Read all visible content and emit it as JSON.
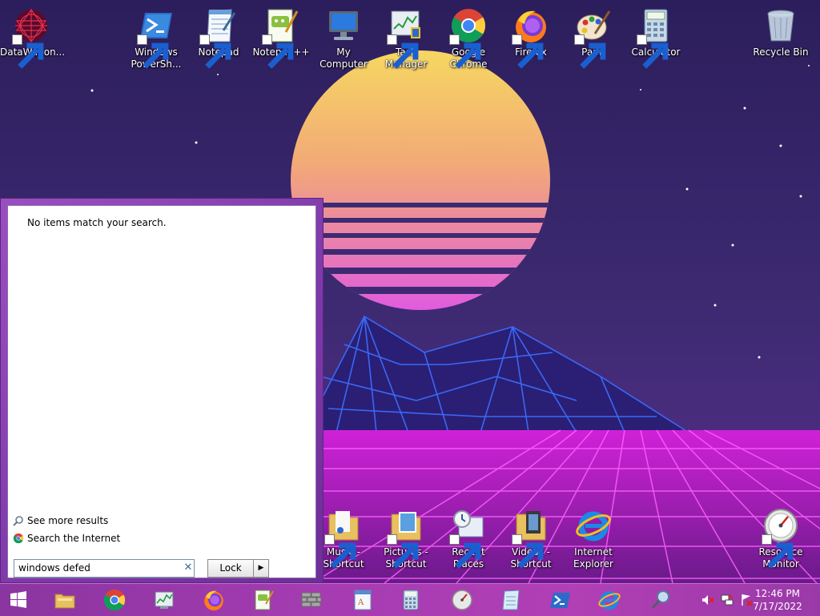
{
  "desktop": {
    "icons": [
      {
        "label": "DataWagon...",
        "icon": "datawagon-icon"
      },
      {
        "label": "Windows PowerSh...",
        "icon": "powershell-icon"
      },
      {
        "label": "Notepad",
        "icon": "notepad-icon"
      },
      {
        "label": "Notepad++",
        "icon": "notepadpp-icon"
      },
      {
        "label": "My Computer",
        "icon": "computer-icon"
      },
      {
        "label": "Task Manager",
        "icon": "task-manager-icon"
      },
      {
        "label": "Google Chrome",
        "icon": "chrome-icon"
      },
      {
        "label": "Firefox",
        "icon": "firefox-icon"
      },
      {
        "label": "Paint",
        "icon": "paint-icon"
      },
      {
        "label": "Calculator",
        "icon": "calculator-icon"
      },
      {
        "label": "Recycle Bin",
        "icon": "recycle-bin-icon"
      },
      {
        "label": "Music - Shortcut",
        "icon": "music-folder-icon"
      },
      {
        "label": "Pictures - Shortcut",
        "icon": "pictures-folder-icon"
      },
      {
        "label": "Recent Places",
        "icon": "recent-places-icon"
      },
      {
        "label": "Videos - Shortcut",
        "icon": "videos-folder-icon"
      },
      {
        "label": "Internet Explorer",
        "icon": "internet-explorer-icon"
      },
      {
        "label": "Resource Monitor",
        "icon": "resource-monitor-icon"
      }
    ]
  },
  "start_menu": {
    "no_items_text": "No items match your search.",
    "see_more_label": "See more results",
    "search_internet_label": "Search the Internet",
    "search_value": "windows defed",
    "clear_symbol": "✕",
    "lock_label": "Lock",
    "lock_arrow_symbol": "▶"
  },
  "taskbar": {
    "items": [
      "start-icon",
      "file-explorer-icon",
      "chrome-icon",
      "task-manager-icon",
      "firefox-icon",
      "notepadpp-icon",
      "wall-icon",
      "wordpad-icon",
      "calculator-icon",
      "clock-gauge-icon",
      "notepad-icon",
      "powershell-icon",
      "internet-explorer-icon",
      "search-icon"
    ],
    "tray_icons": [
      "volume-muted-icon",
      "network-icon",
      "action-center-icon"
    ],
    "time": "12:46 PM",
    "date": "7/17/2022"
  },
  "colors": {
    "taskbar": "#a63cb2",
    "start_menu_frame": "#8a44b4",
    "sun_top": "#f4d060",
    "sun_bottom": "#e060e0",
    "grid": "#ff40ff",
    "mountain_lines": "#3060ff"
  }
}
